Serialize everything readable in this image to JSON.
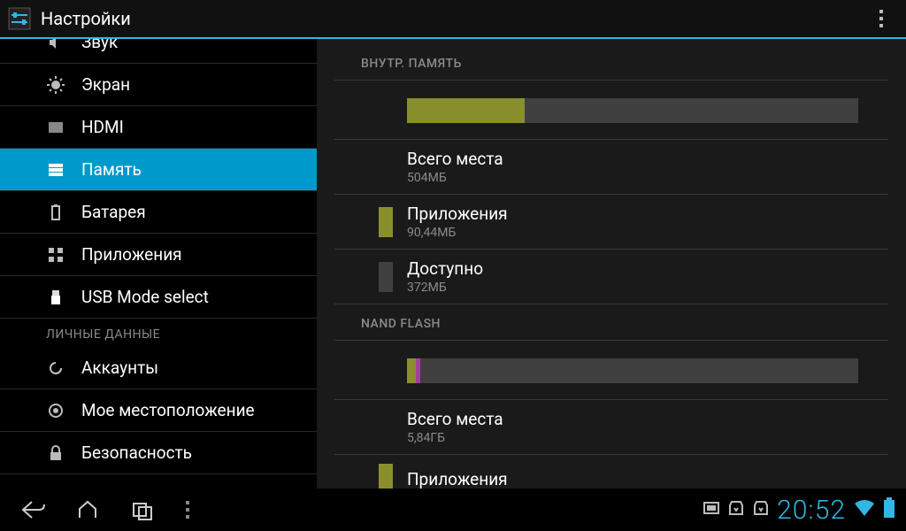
{
  "actionbar": {
    "title": "Настройки"
  },
  "sidebar": {
    "items": [
      {
        "label": "Звук",
        "icon": "sound"
      },
      {
        "label": "Экран",
        "icon": "display"
      },
      {
        "label": "HDMI",
        "icon": "hdmi"
      },
      {
        "label": "Память",
        "icon": "storage",
        "selected": true
      },
      {
        "label": "Батарея",
        "icon": "battery"
      },
      {
        "label": "Приложения",
        "icon": "apps"
      },
      {
        "label": "USB Mode select",
        "icon": "usb"
      }
    ],
    "personal_header": "ЛИЧНЫЕ ДАННЫЕ",
    "personal_items": [
      {
        "label": "Аккаунты",
        "icon": "sync"
      },
      {
        "label": "Мое местоположение",
        "icon": "location"
      },
      {
        "label": "Безопасность",
        "icon": "lock"
      }
    ]
  },
  "detail": {
    "internal": {
      "header": "ВНУТР. ПАМЯТЬ",
      "bar": {
        "used_percent": 26,
        "segments": [
          {
            "color": "#8a8f2e",
            "percent": 26
          }
        ]
      },
      "rows": [
        {
          "swatch": "",
          "label": "Всего места",
          "sub": "504МБ"
        },
        {
          "swatch": "#8a8f2e",
          "label": "Приложения",
          "sub": "90,44МБ"
        },
        {
          "swatch": "#404040",
          "label": "Доступно",
          "sub": "372МБ"
        }
      ]
    },
    "nand": {
      "header": "NAND FLASH",
      "bar": {
        "segments": [
          {
            "color": "#8a8f2e",
            "percent": 2
          },
          {
            "color": "#a040a0",
            "percent": 1
          }
        ]
      },
      "rows": [
        {
          "swatch": "",
          "label": "Всего места",
          "sub": "5,84ГБ"
        },
        {
          "swatch": "#8a8f2e",
          "label": "Приложения",
          "sub": ""
        }
      ]
    }
  },
  "navbar": {
    "clock": "20:52"
  }
}
